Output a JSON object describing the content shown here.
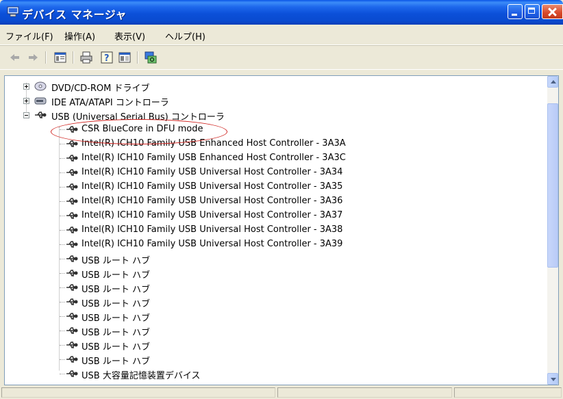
{
  "window": {
    "title": "デバイス マネージャ"
  },
  "menu": {
    "items": [
      "ファイル(F)",
      "操作(A)",
      "表示(V)",
      "ヘルプ(H)"
    ]
  },
  "toolbar": {
    "icons": [
      "back-arrow-icon",
      "forward-arrow-icon",
      "properties-pane-icon",
      "print-icon",
      "help-icon",
      "console-tree-icon",
      "scan-hardware-icon"
    ]
  },
  "tree": {
    "categories": [
      {
        "label": "DVD/CD-ROM ドライブ",
        "expanded": false,
        "icon": "dvd-drive-icon"
      },
      {
        "label": "IDE ATA/ATAPI コントローラ",
        "expanded": false,
        "icon": "ide-controller-icon"
      },
      {
        "label": "USB (Universal Serial Bus) コントローラ",
        "expanded": true,
        "icon": "usb-icon"
      }
    ],
    "usb_devices": [
      "CSR BlueCore in DFU mode",
      "Intel(R) ICH10 Family USB Enhanced Host Controller - 3A3A",
      "Intel(R) ICH10 Family USB Enhanced Host Controller - 3A3C",
      "Intel(R) ICH10 Family USB Universal Host Controller - 3A34",
      "Intel(R) ICH10 Family USB Universal Host Controller - 3A35",
      "Intel(R) ICH10 Family USB Universal Host Controller - 3A36",
      "Intel(R) ICH10 Family USB Universal Host Controller - 3A37",
      "Intel(R) ICH10 Family USB Universal Host Controller - 3A38",
      "Intel(R) ICH10 Family USB Universal Host Controller - 3A39",
      "USB ルート ハブ",
      "USB ルート ハブ",
      "USB ルート ハブ",
      "USB ルート ハブ",
      "USB ルート ハブ",
      "USB ルート ハブ",
      "USB ルート ハブ",
      "USB ルート ハブ",
      "USB 大容量記憶装置デバイス"
    ],
    "highlighted_item": "CSR BlueCore in DFU mode"
  },
  "colors": {
    "titlebar": "#0a4bd0",
    "highlight_circle": "#d0231f",
    "window_face": "#ece9d8"
  }
}
